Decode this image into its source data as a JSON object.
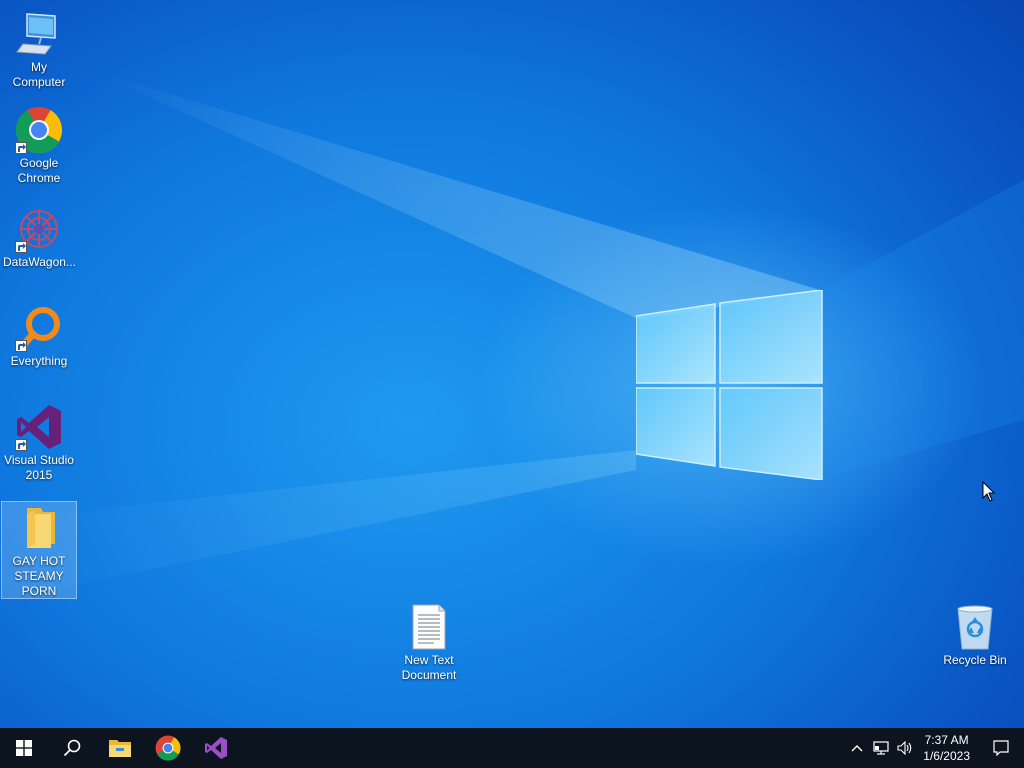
{
  "desktop": {
    "icons": [
      {
        "label": "My Computer",
        "icon": "computer-icon"
      },
      {
        "label": "Google Chrome",
        "icon": "chrome-icon"
      },
      {
        "label": "DataWagon...",
        "icon": "datawagon-icon"
      },
      {
        "label": "Everything",
        "icon": "everything-icon"
      },
      {
        "label": "Visual Studio 2015",
        "icon": "visual-studio-icon"
      },
      {
        "label": "GAY HOT STEAMY PORN",
        "icon": "folder-icon",
        "selected": true
      },
      {
        "label": "New Text Document",
        "icon": "text-document-icon"
      },
      {
        "label": "Recycle Bin",
        "icon": "recycle-bin-icon"
      }
    ]
  },
  "taskbar": {
    "pinned": [
      "start-icon",
      "search-icon",
      "file-explorer-icon",
      "chrome-icon",
      "visual-studio-icon"
    ],
    "clock": {
      "time": "7:37 AM",
      "date": "1/6/2023"
    },
    "tray": [
      "chevron-up-icon",
      "network-icon",
      "volume-icon"
    ]
  },
  "colors": {
    "taskbar": "#0c1420",
    "accent": "#0f78de"
  }
}
